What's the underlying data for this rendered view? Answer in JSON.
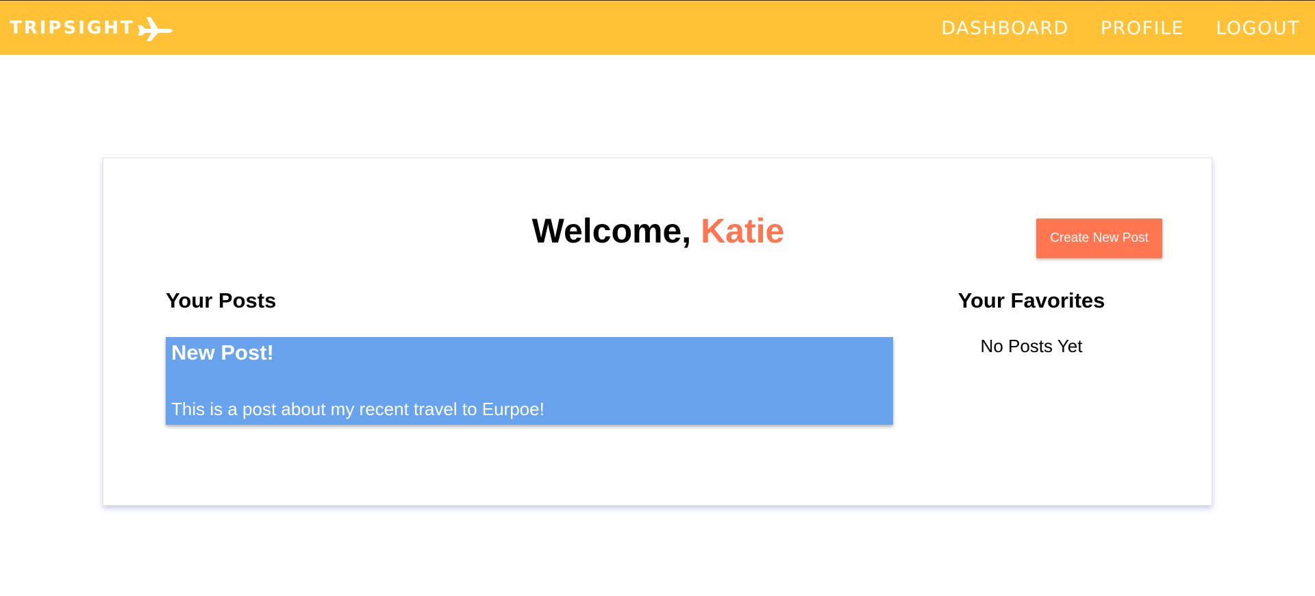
{
  "navbar": {
    "brand": "TRIPSIGHT",
    "brand_icon": "airplane-icon",
    "links": [
      {
        "label": "DASHBOARD"
      },
      {
        "label": "PROFILE"
      },
      {
        "label": "LOGOUT"
      }
    ]
  },
  "dashboard": {
    "welcome_prefix": "Welcome, ",
    "user_name": "Katie",
    "create_button_label": "Create New Post",
    "posts_heading": "Your Posts",
    "posts": [
      {
        "title": "New Post!",
        "body": "This is a post about my recent travel to Eurpoe!"
      }
    ],
    "favorites_heading": "Your Favorites",
    "favorites_empty_text": "No Posts Yet"
  },
  "colors": {
    "navbar": "#ffc236",
    "accent": "#ff7651",
    "post_card": "#69a3ee"
  }
}
